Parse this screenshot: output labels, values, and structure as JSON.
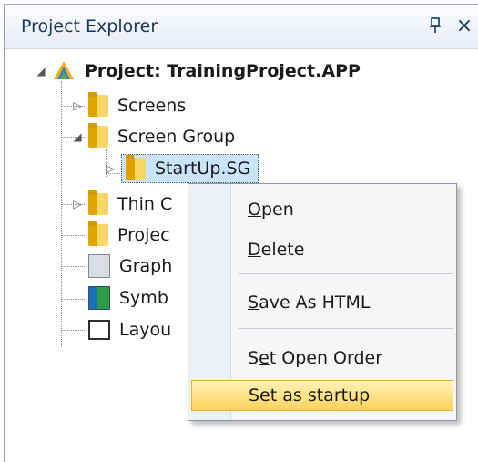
{
  "panel": {
    "title": "Project Explorer",
    "pin_glyph": "ꟷ",
    "close_glyph": "×"
  },
  "tree": {
    "project": "Project: TrainingProject.APP",
    "items": [
      {
        "label": "Screens",
        "icon": "folder-icon"
      },
      {
        "label": "Screen Group",
        "icon": "folder-icon"
      },
      {
        "label": "StartUp.SG",
        "icon": "folder-icon"
      },
      {
        "label": "Thin C",
        "icon": "folder-icon"
      },
      {
        "label": "Projec",
        "icon": "folder-icon"
      },
      {
        "label": "Graph",
        "icon": "graphic-icon"
      },
      {
        "label": "Symb",
        "icon": "symbol-icon"
      },
      {
        "label": "Layou",
        "icon": "layout-icon"
      }
    ]
  },
  "menu": {
    "open": {
      "underline": "O",
      "rest": "pen"
    },
    "delete": {
      "underline": "D",
      "rest": "elete"
    },
    "save_html": {
      "underline": "S",
      "rest": "ave As HTML"
    },
    "set_open_order": {
      "pre": "S",
      "underline": "e",
      "rest": "t Open Order"
    },
    "set_startup": "Set as startup"
  },
  "colors": {
    "title_text": "#17375e",
    "selection": "#c9e4fb",
    "menu_hover": "#fbd35a"
  }
}
